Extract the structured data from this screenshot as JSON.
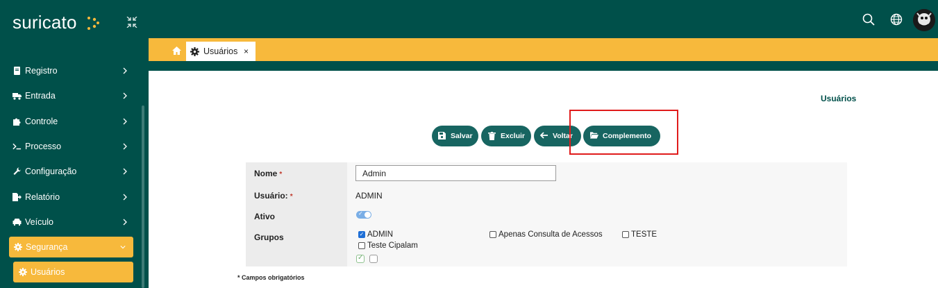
{
  "app": {
    "logo": "suricato",
    "colors": {
      "primary": "#00504a",
      "accent": "#f7b93c",
      "button": "#176561",
      "highlight": "#e01b1b"
    }
  },
  "sidebar": {
    "items": [
      {
        "label": "Registro",
        "icon": "book-icon"
      },
      {
        "label": "Entrada",
        "icon": "truck-icon"
      },
      {
        "label": "Controle",
        "icon": "puzzle-icon"
      },
      {
        "label": "Processo",
        "icon": "terminal-icon"
      },
      {
        "label": "Configuração",
        "icon": "wrench-icon"
      },
      {
        "label": "Relatório",
        "icon": "report-icon"
      },
      {
        "label": "Veículo",
        "icon": "car-icon"
      },
      {
        "label": "Segurança",
        "icon": "gear-icon"
      }
    ],
    "subitem": {
      "label": "Usuários",
      "icon": "gear-icon"
    }
  },
  "tabs": [
    {
      "label": "Usuários",
      "close": "×"
    }
  ],
  "page": {
    "title": "Usuários"
  },
  "toolbar": {
    "save": "Salvar",
    "delete": "Excluir",
    "back": "Voltar",
    "complement": "Complemento"
  },
  "form": {
    "nome_label": "Nome",
    "nome_value": "Admin",
    "usuario_label": "Usuário:",
    "usuario_value": "ADMIN",
    "ativo_label": "Ativo",
    "ativo_on": true,
    "grupos_label": "Grupos",
    "required_mark": "*",
    "groups": [
      {
        "label": "ADMIN",
        "checked": true
      },
      {
        "label": "Apenas Consulta de Acessos",
        "checked": false
      },
      {
        "label": "TESTE",
        "checked": false
      },
      {
        "label": "Teste Cipalam",
        "checked": false
      }
    ],
    "footnote": "* Campos obrigatórios"
  }
}
